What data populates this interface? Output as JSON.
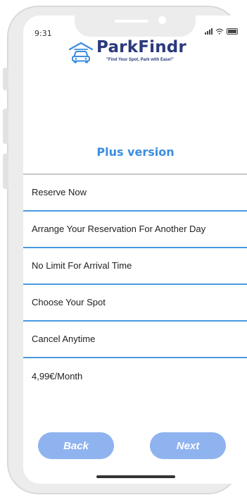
{
  "status_bar": {
    "time": "9:31"
  },
  "brand": {
    "name": "ParkFindr",
    "tagline": "\"Find Your Spot, Park with Ease!\"",
    "color": "#2a3a7c"
  },
  "plan": {
    "title": "Plus version",
    "accent_color": "#3b8de0",
    "features": [
      "Reserve Now",
      "Arrange Your Reservation For Another Day",
      "No Limit For Arrival Time",
      "Choose Your Spot",
      "Cancel Anytime",
      "4,99€/Month"
    ]
  },
  "actions": {
    "back_label": "Back",
    "next_label": "Next",
    "button_color": "#8fb3ef"
  }
}
